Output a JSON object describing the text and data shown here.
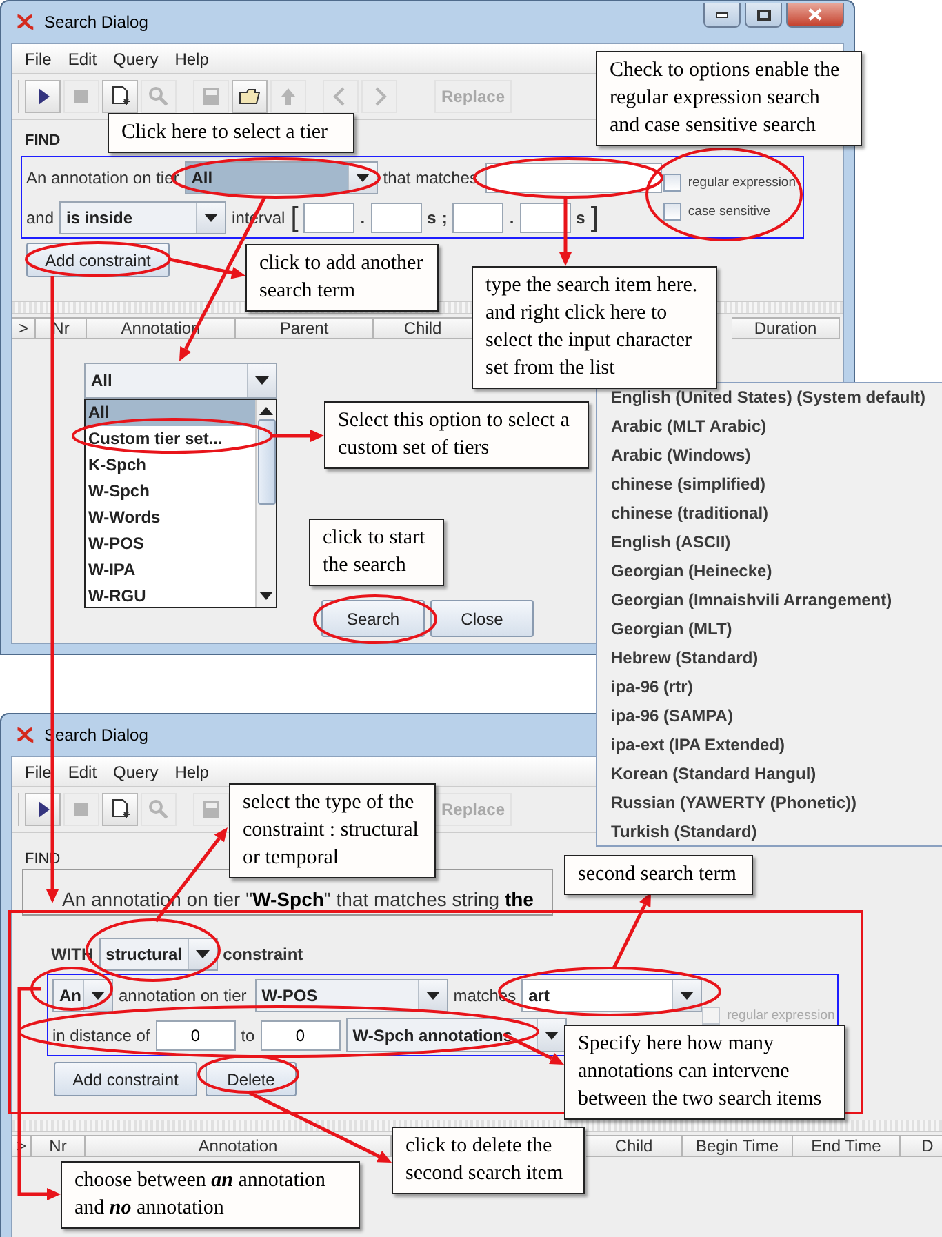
{
  "top_dialog": {
    "title": "Search Dialog",
    "menu": [
      "File",
      "Edit",
      "Query",
      "Help"
    ],
    "toolbar": [
      {
        "kind": "play",
        "disabled": false
      },
      {
        "kind": "stop",
        "disabled": true
      },
      {
        "kind": "new",
        "disabled": false
      },
      {
        "kind": "find",
        "disabled": true
      },
      {
        "kind": "save",
        "disabled": true
      },
      {
        "kind": "open",
        "disabled": false
      },
      {
        "kind": "export",
        "disabled": true
      },
      {
        "kind": "back",
        "disabled": true
      },
      {
        "kind": "forward",
        "disabled": true
      },
      {
        "kind": "text",
        "label": "Replace",
        "disabled": true
      }
    ],
    "find_label": "FIND",
    "tier_label": "An annotation on tier",
    "tier_value": "All",
    "matches_label": "that matches",
    "checkboxes": [
      {
        "label": "regular expression",
        "checked": false,
        "disabled": false
      },
      {
        "label": "case sensitive",
        "checked": false,
        "disabled": false
      }
    ],
    "and_label": "and",
    "relation_value": "is inside",
    "interval_label": "interval",
    "interval": {
      "open": "[",
      "start": {
        "separator": ".",
        "unit": "s"
      },
      "divider": ";",
      "end": {
        "separator": ".",
        "unit": "s"
      },
      "close": "]"
    },
    "add_button": "Add constraint",
    "columns": [
      ">",
      "Nr",
      "Annotation",
      "Parent",
      "Child",
      "Duration"
    ],
    "tier_dropdown": {
      "value": "All",
      "options": [
        {
          "label": "All",
          "selected": true
        },
        {
          "label": "Custom tier set...",
          "selected": false
        },
        {
          "label": "K-Spch",
          "selected": false
        },
        {
          "label": "W-Spch",
          "selected": false
        },
        {
          "label": "W-Words",
          "selected": false
        },
        {
          "label": "W-POS",
          "selected": false
        },
        {
          "label": "W-IPA",
          "selected": false
        },
        {
          "label": "W-RGU",
          "selected": false
        }
      ]
    },
    "buttons": [
      "Search",
      "Close"
    ]
  },
  "charset_menu": [
    "English (United States) (System default)",
    "Arabic (MLT Arabic)",
    "Arabic (Windows)",
    "chinese (simplified)",
    "chinese (traditional)",
    "English (ASCII)",
    "Georgian (Heinecke)",
    "Georgian (Imnaishvili Arrangement)",
    "Georgian (MLT)",
    "Hebrew (Standard)",
    "ipa-96 (rtr)",
    "ipa-96 (SAMPA)",
    "ipa-ext (IPA Extended)",
    "Korean (Standard Hangul)",
    "Russian (YAWERTY (Phonetic))",
    "Turkish (Standard)"
  ],
  "bottom_dialog": {
    "title": "Search Dialog",
    "menu": [
      "File",
      "Edit",
      "Query",
      "Help"
    ],
    "toolbar": [
      {
        "kind": "play",
        "disabled": false
      },
      {
        "kind": "stop",
        "disabled": true
      },
      {
        "kind": "new",
        "disabled": false
      },
      {
        "kind": "find",
        "disabled": true
      },
      {
        "kind": "save",
        "disabled": true
      },
      {
        "kind": "text",
        "label": "Replace",
        "disabled": true
      }
    ],
    "find_label": "FIND",
    "summary": "An annotation on tier \"**W-Spch**\" that matches string **the**",
    "with_label": "WITH",
    "constraint_type": "structural",
    "constraint_label": "constraint",
    "quantifier": "An",
    "tier_label": "annotation on tier",
    "tier_value": "W-POS",
    "matches_label": "matches",
    "matches_value": "art",
    "checkbox": {
      "label": "regular expression",
      "checked": false,
      "disabled": true
    },
    "distance_label": "in distance of",
    "distance_from": "0",
    "to_label": "to",
    "distance_to": "0",
    "distance_unit": "W-Spch annotations",
    "buttons": [
      "Add constraint",
      "Delete"
    ],
    "columns": [
      ">",
      "Nr",
      "Annotation",
      "Child",
      "Begin Time",
      "End Time",
      "D"
    ]
  },
  "callouts": [
    "Click here to select a tier",
    "Check to options enable the regular expression search and case sensitive search",
    "click to add another search term",
    "type the search item here. and right click here to select the input character  set from the list",
    "Select this option to select a custom set of tiers",
    "click to start the search",
    "select the type of the constraint : structural or temporal",
    "second search term",
    "Specify here how many annotations can intervene between the two search items",
    "click to delete the second search item",
    "choose between **an** annotation and **no** annotation"
  ]
}
